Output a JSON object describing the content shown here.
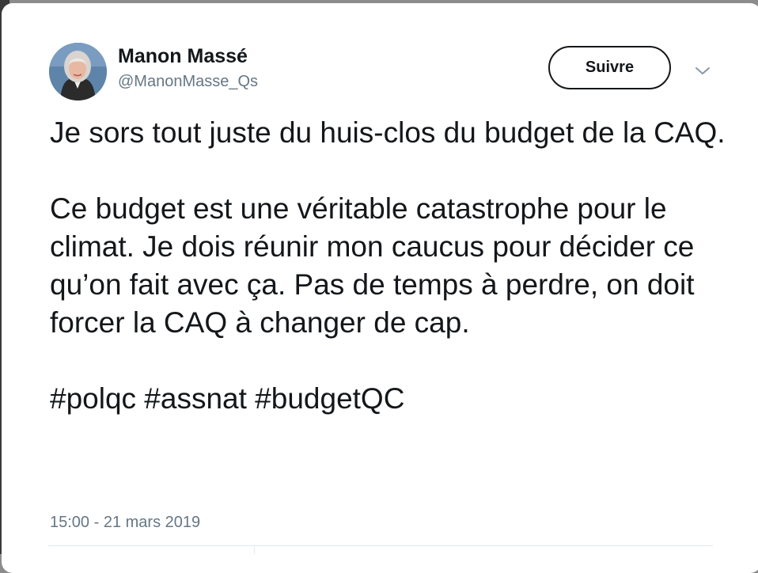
{
  "tweet": {
    "author": {
      "name": "Manon Massé",
      "handle": "@ManonMasse_Qs"
    },
    "follow_label": "Suivre",
    "menu_icon": "chevron-down-icon",
    "paragraphs": [
      "Je sors tout juste du huis-clos du budget de la CAQ.",
      "Ce budget est une véritable catastrophe pour le climat. Je dois réunir mon caucus pour décider ce qu’on fait avec ça. Pas de temps à perdre, on doit forcer la CAQ à changer de cap.",
      "#polqc #assnat #budgetQC"
    ],
    "timestamp": "15:00 - 21 mars 2019"
  },
  "colors": {
    "text": "#14171a",
    "secondary": "#657786",
    "border": "#e1e8ed",
    "card": "#ffffff"
  }
}
